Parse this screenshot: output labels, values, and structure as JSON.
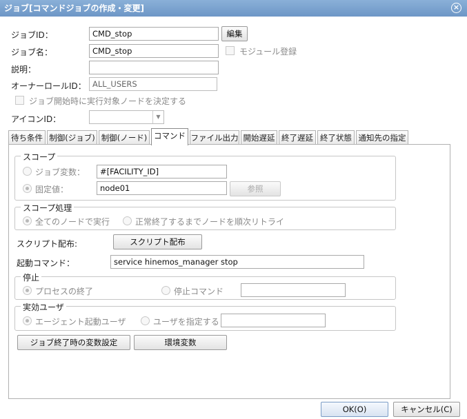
{
  "window": {
    "title": "ジョブ[コマンドジョブの作成・変更]"
  },
  "form": {
    "job_id_label": "ジョブID：",
    "job_id_value": "CMD_stop",
    "edit_button": "編集",
    "job_name_label": "ジョブ名：",
    "job_name_value": "CMD_stop",
    "module_register_label": "モジュール登録",
    "description_label": "説明：",
    "description_value": "",
    "owner_role_label": "オーナーロールID：",
    "owner_role_value": "ALL_USERS",
    "decide_node_label": "ジョブ開始時に実行対象ノードを決定する",
    "icon_id_label": "アイコンID：",
    "icon_id_value": ""
  },
  "tabs": [
    {
      "label": "待ち条件"
    },
    {
      "label": "制御(ジョブ)"
    },
    {
      "label": "制御(ノード)"
    },
    {
      "label": "コマンド"
    },
    {
      "label": "ファイル出力"
    },
    {
      "label": "開始遅延"
    },
    {
      "label": "終了遅延"
    },
    {
      "label": "終了状態"
    },
    {
      "label": "通知先の指定"
    }
  ],
  "command": {
    "scope_title": "スコープ",
    "job_variable_label": "ジョブ変数：",
    "job_variable_value": "#[FACILITY_ID]",
    "fixed_value_label": "固定値：",
    "fixed_value_value": "node01",
    "browse_button": "参照",
    "scope_processing_title": "スコープ処理",
    "all_nodes_label": "全てのノードで実行",
    "retry_label": "正常終了するまでノードを順次リトライ",
    "script_distribution_label": "スクリプト配布:",
    "script_distribution_button": "スクリプト配布",
    "start_command_label": "起動コマンド：",
    "start_command_value": "service hinemos_manager stop",
    "stop_title": "停止",
    "process_end_label": "プロセスの終了",
    "stop_command_label": "停止コマンド",
    "stop_command_value": "",
    "effective_user_title": "実効ユーザ",
    "agent_user_label": "エージェント起動ユーザ",
    "specify_user_label": "ユーザを指定する",
    "specify_user_value": "",
    "var_settings_button": "ジョブ終了時の変数設定",
    "env_vars_button": "環境変数"
  },
  "footer": {
    "ok_button": "OK(O)",
    "cancel_button": "キャンセル(C)"
  }
}
